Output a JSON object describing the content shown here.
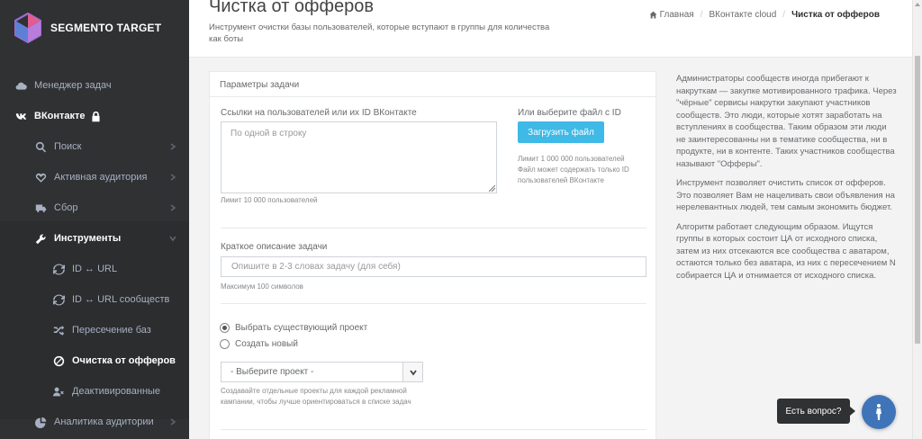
{
  "brand": {
    "name": "SEGMENTO TARGET"
  },
  "sidebar": {
    "items": [
      {
        "label": "Менеджер задач",
        "icon": "cloud-icon"
      },
      {
        "label": "ВКонтакте",
        "icon": "vk-icon",
        "lock_icon": "lock-icon"
      },
      {
        "label": "Поиск",
        "icon": "search-icon"
      },
      {
        "label": "Активная аудитория",
        "icon": "heart-icon"
      },
      {
        "label": "Сбор",
        "icon": "truck-icon"
      },
      {
        "label": "Инструменты",
        "icon": "wrench-icon"
      },
      {
        "label": "ID ↔ URL",
        "icon": "refresh-icon"
      },
      {
        "label": "ID ↔ URL сообществ",
        "icon": "refresh-icon"
      },
      {
        "label": "Пересечение баз",
        "icon": "shuffle-icon"
      },
      {
        "label": "Очистка от офферов",
        "icon": "ban-icon"
      },
      {
        "label": "Деактивированные",
        "icon": "user-times-icon"
      },
      {
        "label": "Аналитика аудитории",
        "icon": "pie-chart-icon"
      }
    ]
  },
  "header": {
    "title": "Чистка от офферов",
    "description": "Инструмент очистки базы пользователей, которые вступают в группы для количества как боты",
    "breadcrumb": [
      "Главная",
      "ВКонтакте cloud",
      "Чистка от офферов"
    ]
  },
  "form": {
    "panel_title": "Параметры задачи",
    "links_label": "Ссылки на пользователей или их ID ВКонтакте",
    "links_placeholder": "По одной в строку",
    "links_hint": "Лимит 10 000 пользователей",
    "file_label": "Или выберите файл с ID",
    "upload_button": "Загрузить файл",
    "file_hint": "Лимит 1 000 000 пользователей\nФайл может содержать только ID пользователей ВКонтакте",
    "desc_label": "Краткое описание задачи",
    "desc_placeholder": "Опишите в 2-3 словах задачу (для себя)",
    "desc_hint": "Максимум 100 символов",
    "radio_existing": "Выбрать существующий проект",
    "radio_new": "Создать новый",
    "project_select": "- Выберите проект -",
    "project_hint": "Создавайте отдельные проекты для каждой рекламной кампании, чтобы лучше ориентироваться в списке задач"
  },
  "info": {
    "p1": "Администраторы сообществ иногда прибегают к накруткам — закупке мотивированного трафика. Через \"чёрные\" сервисы накрутки закупают участников сообществ. Это люди, которые хотят заработать на вступлениях в сообщества. Таким образом эти люди не заинтересованны ни в тематике сообщества, ни в продукте, ни в контенте. Таких участников сообщества называют \"Офферы\".",
    "p2": "Инструмент позволяет очистить список от офферов. Это позволяет Вам не нацеливать свои объявления на нерелевантных людей, тем самым экономить бюджет.",
    "p3": "Алгоритм работает следующим образом. Ищутся группы в которых состоит ЦА от исходного списка, затем из них отсекаются все сообщества с аватаром, остаются только без аватара, из них с пересечением N собирается ЦА и отнимается от исходного списка."
  },
  "chat": {
    "label": "Есть вопрос?"
  }
}
